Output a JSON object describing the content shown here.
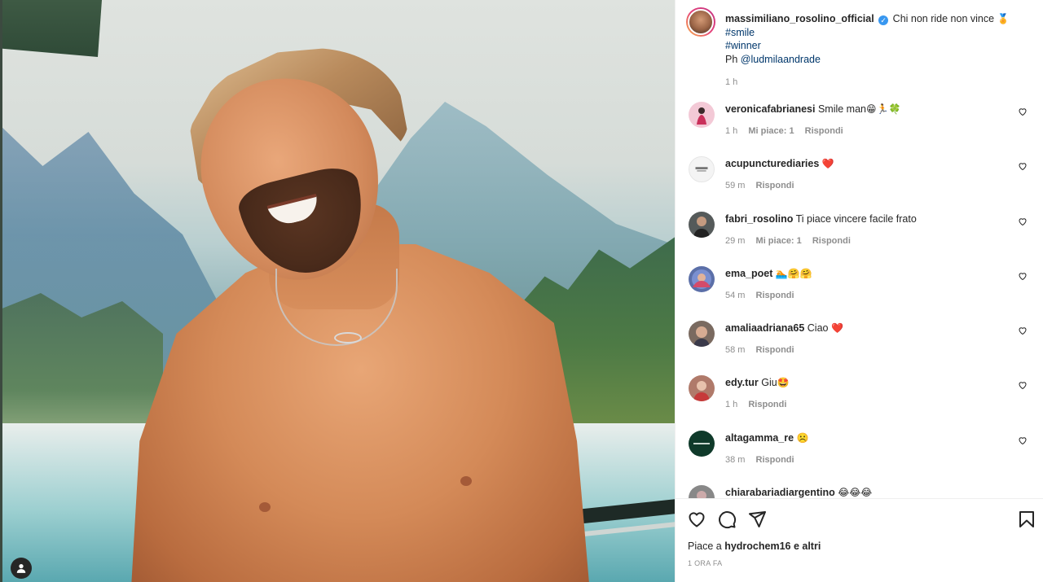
{
  "post": {
    "author": "massimiliano_rosolino_official",
    "caption_text": "Chi non ride non vince",
    "caption_emoji": "🏅",
    "hashtags": [
      "#smile",
      "#winner"
    ],
    "photo_credit_prefix": "Ph",
    "photo_credit_user": "@ludmilaandrade",
    "time": "1 h"
  },
  "comments": [
    {
      "user": "veronicafabrianesi",
      "text": "Smile man",
      "emoji": "😁🏃🍀",
      "time": "1 h",
      "likes": "Mi piace: 1",
      "reply": "Rispondi",
      "avatar_color": "#f3c9d6"
    },
    {
      "user": "acupuncturediaries",
      "text": "",
      "emoji": "❤️",
      "time": "59 m",
      "likes": "",
      "reply": "Rispondi",
      "avatar_color": "#f4f4f4"
    },
    {
      "user": "fabri_rosolino",
      "text": "Ti piace vincere facile frato",
      "emoji": "",
      "time": "29 m",
      "likes": "Mi piace: 1",
      "reply": "Rispondi",
      "avatar_color": "#555a5a"
    },
    {
      "user": "ema_poet",
      "text": "",
      "emoji": "🏊🤗🤗",
      "time": "54 m",
      "likes": "",
      "reply": "Rispondi",
      "avatar_color": "#5b6fa8"
    },
    {
      "user": "amaliaadriana65",
      "text": "Ciao",
      "emoji": "❤️",
      "time": "58 m",
      "likes": "",
      "reply": "Rispondi",
      "avatar_color": "#7a6a60"
    },
    {
      "user": "edy.tur",
      "text": "Giu",
      "emoji": "🤩",
      "time": "1 h",
      "likes": "",
      "reply": "Rispondi",
      "avatar_color": "#b07a6a"
    },
    {
      "user": "altagamma_re",
      "text": "",
      "emoji": "☹️",
      "time": "38 m",
      "likes": "",
      "reply": "Rispondi",
      "avatar_color": "#0f3a2a"
    },
    {
      "user": "chiarabariadiargentino",
      "text": "",
      "emoji": "😂😂😂",
      "time": "",
      "likes": "",
      "reply": "",
      "avatar_color": "#888888"
    }
  ],
  "footer": {
    "likes_prefix": "Piace a",
    "likes_user": "hydrochem16",
    "likes_suffix": "e altri",
    "time_ago": "1 ora fa"
  },
  "icons": {
    "like": "heart-icon",
    "comment": "comment-icon",
    "share": "send-icon",
    "save": "bookmark-icon",
    "tag": "user-tag-icon"
  }
}
